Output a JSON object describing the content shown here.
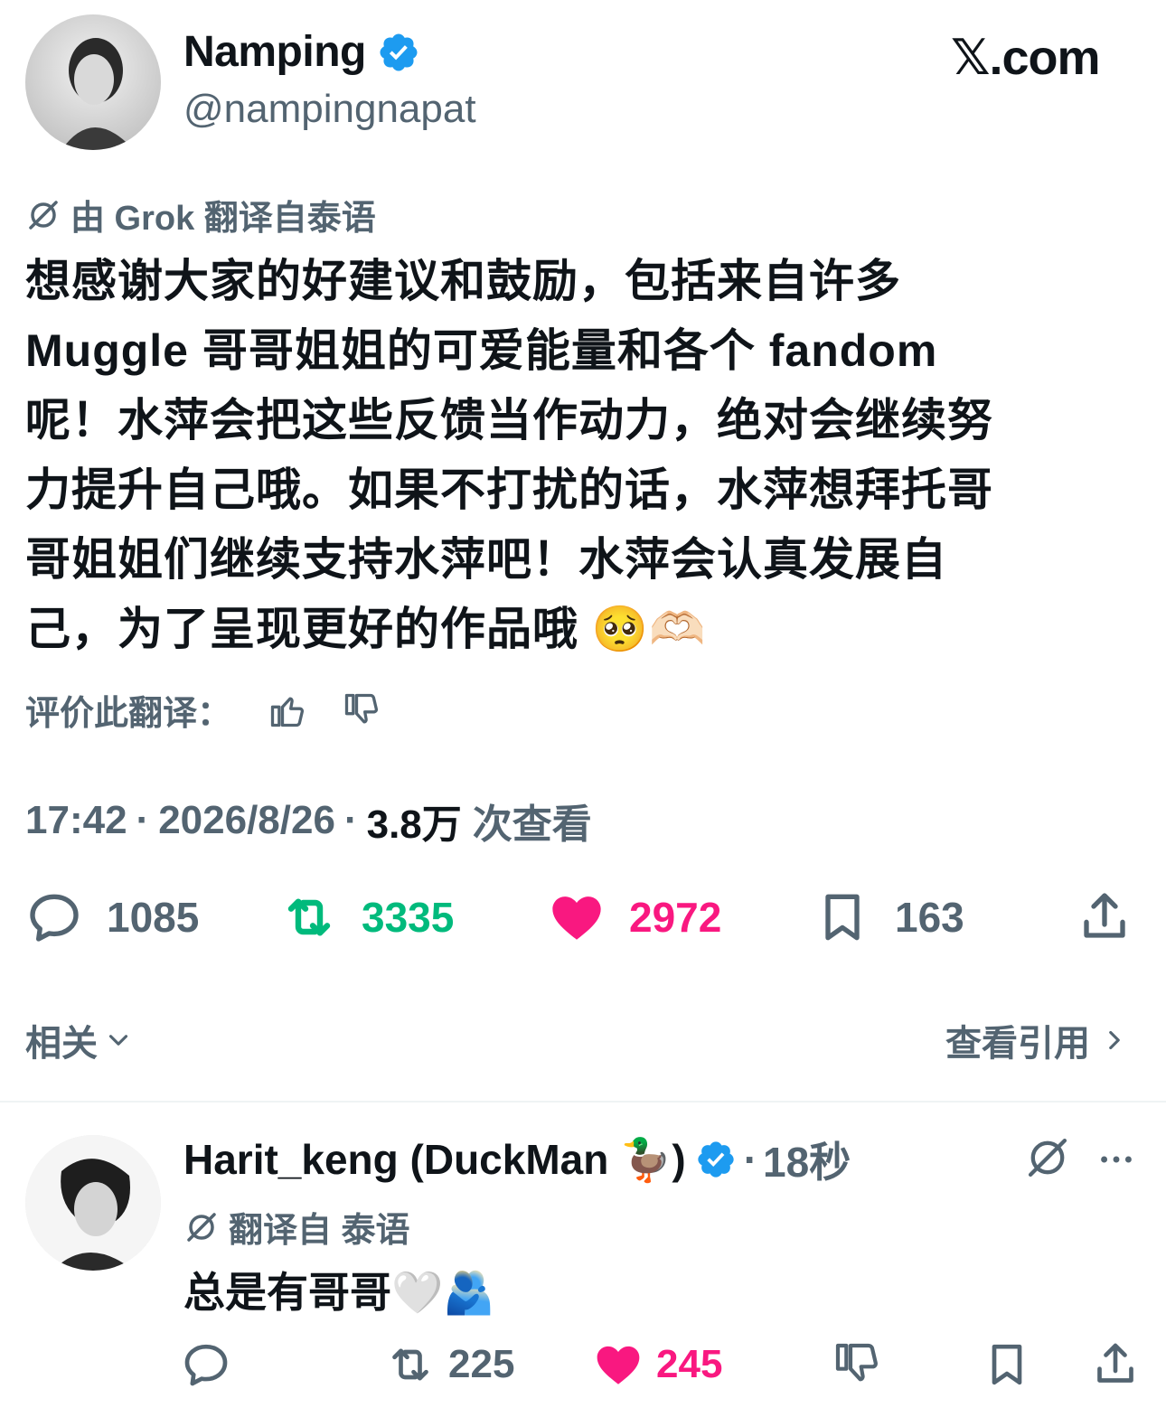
{
  "header": {
    "display_name": "Namping",
    "handle": "@nampingnapat",
    "site_label": "𝕏.com"
  },
  "translation": {
    "label": "由 Grok 翻译自泰语"
  },
  "tweet": {
    "text": "想感谢大家的好建议和鼓励，包括来自许多\nMuggle 哥哥姐姐的可爱能量和各个 fandom\n呢！水萍会把这些反馈当作动力，绝对会继续努\n力提升自己哦。如果不打扰的话，水萍想拜托哥\n哥姐姐们继续支持水萍吧！水萍会认真发展自\n己，为了呈现更好的作品哦 🥺🫶🏻"
  },
  "rate": {
    "label": "评价此翻译："
  },
  "meta": {
    "time": "17:42",
    "date": "2026/8/26",
    "views_count": "3.8万",
    "views_label": "次查看",
    "separator": "·"
  },
  "actions": {
    "replies": "1085",
    "retweets": "3335",
    "likes": "2972",
    "bookmarks": "163"
  },
  "colors": {
    "retweet": "#00ba7c",
    "like": "#f91880",
    "verified": "#1d9bf0",
    "secondary": "#536471"
  },
  "related": {
    "left_label": "相关",
    "right_label": "查看引用"
  },
  "reply": {
    "display_name": "Harit_keng (DuckMan 🦆)",
    "time": "18秒",
    "separator": "·",
    "translation_label": "翻译自 泰语",
    "text": "总是有哥哥🤍🫂",
    "retweets": "225",
    "likes": "245"
  }
}
